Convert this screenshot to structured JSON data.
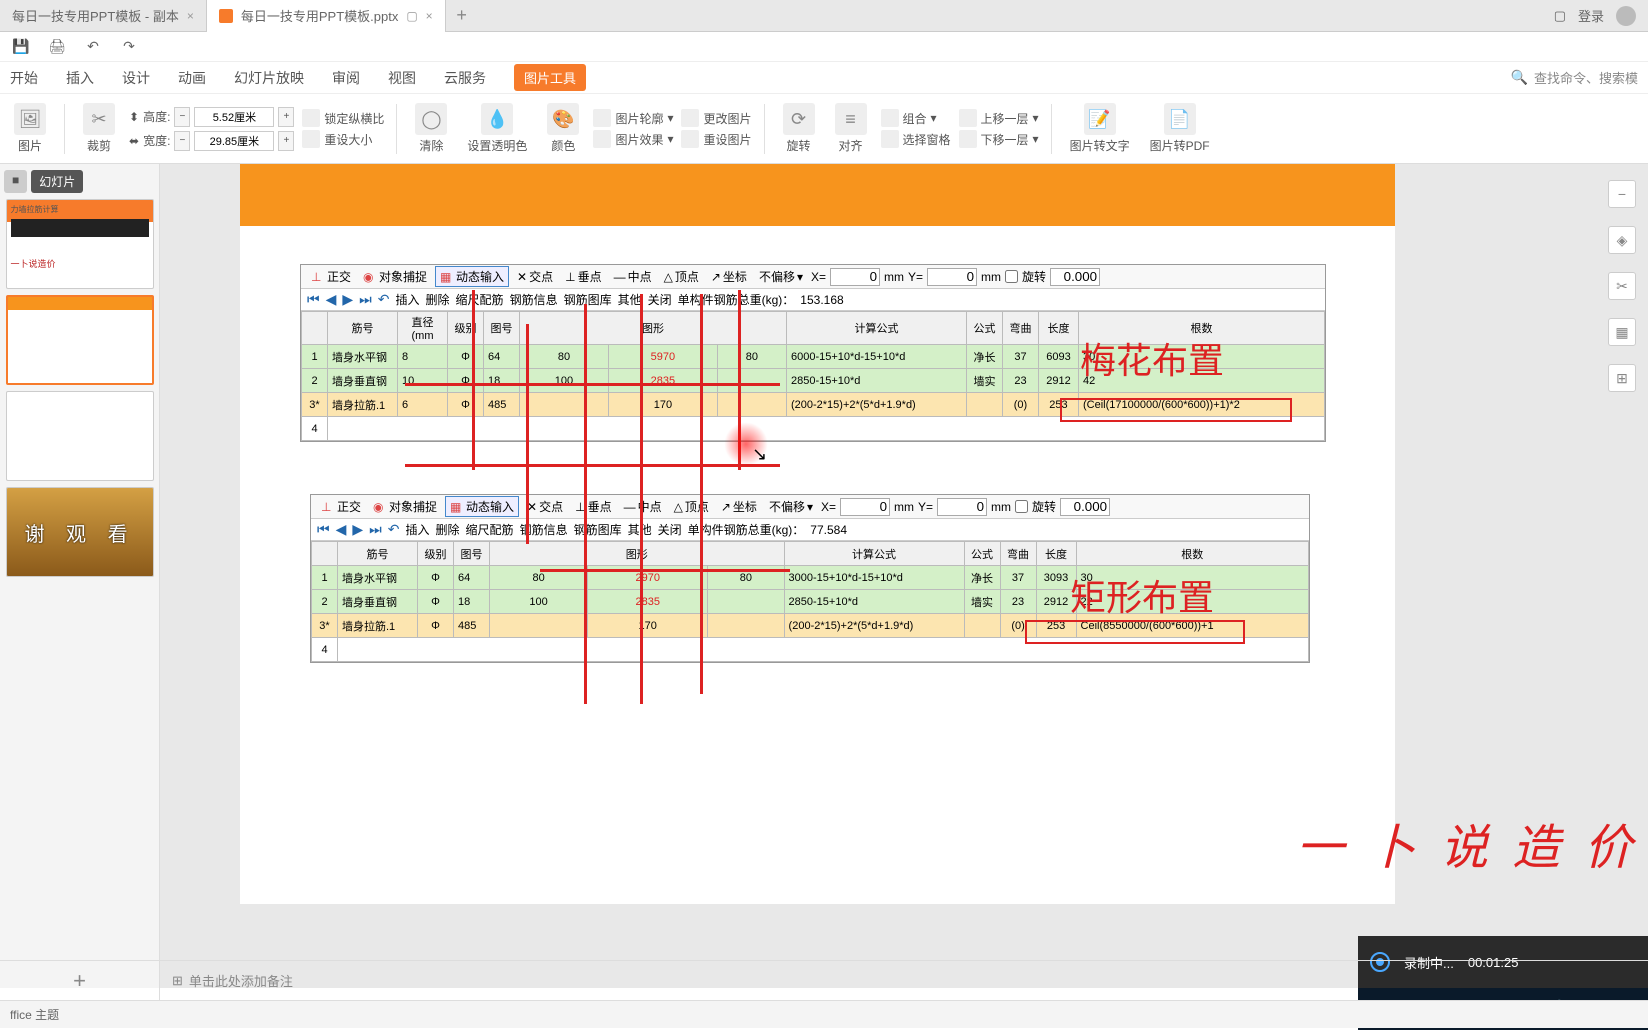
{
  "titlebar": {
    "tab1": "每日一技专用PPT模板 - 副本",
    "tab2": "每日一技专用PPT模板.pptx",
    "login": "登录"
  },
  "menubar": {
    "items": [
      "开始",
      "插入",
      "设计",
      "动画",
      "幻灯片放映",
      "审阅",
      "视图",
      "云服务"
    ],
    "active": "图片工具",
    "search_placeholder": "查找命令、搜索模"
  },
  "ribbon": {
    "image": "图片",
    "crop": "裁剪",
    "height_label": "高度:",
    "height_val": "5.52厘米",
    "width_label": "宽度:",
    "width_val": "29.85厘米",
    "lock_ratio": "锁定纵横比",
    "reset_size": "重设大小",
    "clear": "清除",
    "set_trans": "设置透明色",
    "color": "颜色",
    "outline": "图片轮廓",
    "effect": "图片效果",
    "change": "更改图片",
    "reset": "重设图片",
    "rotate": "旋转",
    "align": "对齐",
    "group": "组合",
    "select_pane": "选择窗格",
    "up_layer": "上移一层",
    "down_layer": "下移一层",
    "to_text": "图片转文字",
    "to_pdf": "图片转PDF"
  },
  "sidebar": {
    "slides_btn": "幻灯片",
    "thumb1_title": "力墙拉筋计算",
    "thumb1_logo": "一卜说造价",
    "thumb4_text": "谢 观 看"
  },
  "panel1": {
    "toolbar": {
      "ortho": "正交",
      "snap": "对象捕捉",
      "dyn": "动态输入",
      "cross": "交点",
      "perp": "垂点",
      "mid": "中点",
      "top": "顶点",
      "coord": "坐标",
      "offset": "不偏移",
      "x": "X=",
      "xval": "0",
      "mm": "mm",
      "y": "Y=",
      "yval": "0",
      "rotate": "旋转",
      "rotval": "0.000"
    },
    "subbar": {
      "insert": "插入",
      "delete": "删除",
      "scale": "缩尺配筋",
      "rebar_info": "钢筋信息",
      "rebar_lib": "钢筋图库",
      "other": "其他",
      "close": "关闭",
      "total_label": "单构件钢筋总重(kg)：",
      "total_val": "153.168"
    },
    "headers": [
      "",
      "筋号",
      "直径(mm",
      "级别",
      "图号",
      "",
      "图形",
      "",
      "计算公式",
      "公式",
      "弯曲",
      "长度",
      "",
      "根数"
    ],
    "rows": [
      {
        "n": "1",
        "name": "墙身水平钢",
        "dia": "8",
        "lvl": "Φ",
        "code": "64",
        "a": "80",
        "shape": "5970",
        "b": "80",
        "formula": "6000-15+10*d-15+10*d",
        "fx": "净长",
        "bend": "37",
        "len": "6093",
        "ex": "30"
      },
      {
        "n": "2",
        "name": "墙身垂直钢",
        "dia": "10",
        "lvl": "Φ",
        "code": "18",
        "a": "100",
        "shape": "2835",
        "b": "",
        "formula": "2850-15+10*d",
        "fx": "墙实",
        "bend": "23",
        "len": "2912",
        "ex": "42"
      },
      {
        "n": "3*",
        "name": "墙身拉筋.1",
        "dia": "6",
        "lvl": "Φ",
        "code": "485",
        "a": "",
        "shape": "170",
        "b": "",
        "formula": "(200-2*15)+2*(5*d+1.9*d)",
        "fx": "",
        "bend": "(0)",
        "len": "253",
        "ex": "(Ceil(17100000/(600*600))+1)*2"
      },
      {
        "n": "4"
      }
    ],
    "big_label": "梅花布置"
  },
  "panel2": {
    "total_val": "77.584",
    "headers": [
      "",
      "筋号",
      "级别",
      "图号",
      "",
      "图形",
      "",
      "计算公式",
      "公式",
      "弯曲",
      "长度",
      "根数"
    ],
    "rows": [
      {
        "n": "1",
        "name": "墙身水平钢",
        "lvl": "Φ",
        "code": "64",
        "a": "80",
        "shape": "2970",
        "b": "80",
        "formula": "3000-15+10*d-15+10*d",
        "fx": "净长",
        "bend": "37",
        "len": "3093",
        "ex": "30"
      },
      {
        "n": "2",
        "name": "墙身垂直钢",
        "lvl": "Φ",
        "code": "18",
        "a": "100",
        "shape": "2835",
        "b": "",
        "formula": "2850-15+10*d",
        "fx": "墙实",
        "bend": "23",
        "len": "2912",
        "ex": "22"
      },
      {
        "n": "3*",
        "name": "墙身拉筋.1",
        "lvl": "Φ",
        "code": "485",
        "a": "",
        "shape": "170",
        "b": "",
        "formula": "(200-2*15)+2*(5*d+1.9*d)",
        "fx": "",
        "bend": "(0)",
        "len": "253",
        "ex": "Ceil(8550000/(600*600))+1"
      },
      {
        "n": "4"
      }
    ],
    "big_label": "矩形布置"
  },
  "watermark": "一 卜 说 造 价",
  "recording": {
    "label": "录制中...",
    "time": "00:01:25"
  },
  "bottom": {
    "notes_placeholder": "单击此处添加备注",
    "theme": "ffice 主题"
  }
}
